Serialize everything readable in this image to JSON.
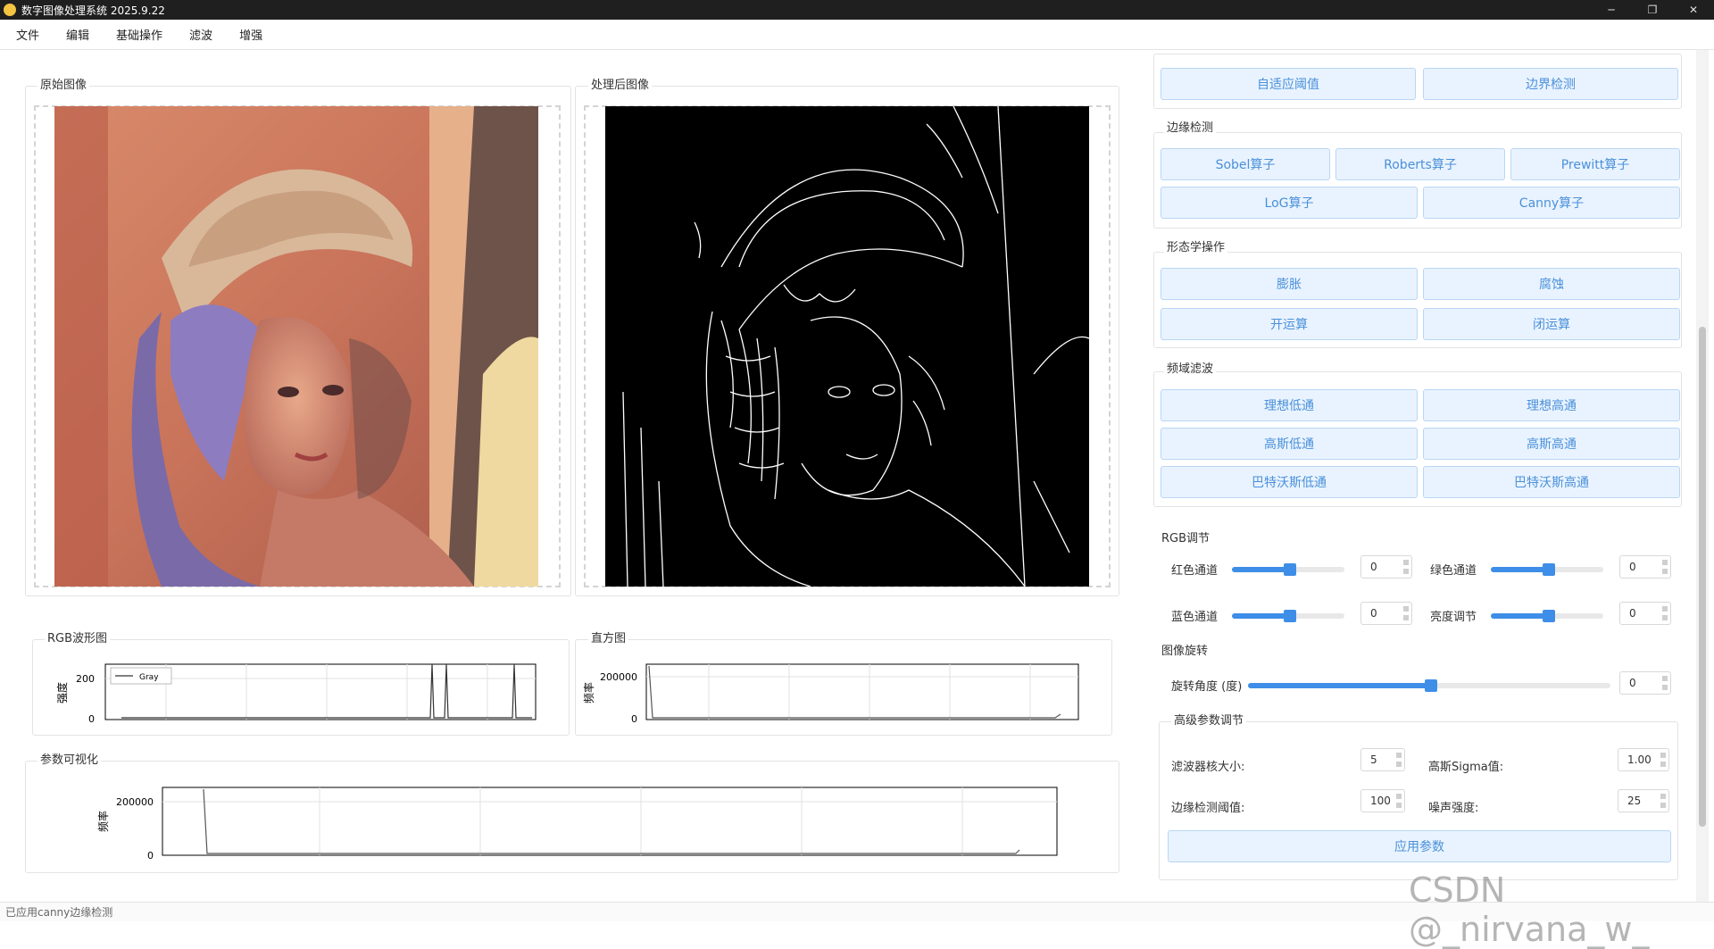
{
  "window": {
    "title": "数字图像处理系统 2025.9.22",
    "minimize": "─",
    "maximize": "❐",
    "close": "✕"
  },
  "menu": [
    "文件",
    "编辑",
    "基础操作",
    "滤波",
    "增强"
  ],
  "panels": {
    "original_title": "原始图像",
    "processed_title": "处理后图像",
    "rgb_wave_title": "RGB波形图",
    "histogram_title": "直方图",
    "param_vis_title": "参数可视化"
  },
  "rgb_wave": {
    "ylabel": "强度",
    "legend": "Gray",
    "y_ticks": [
      "200",
      "0"
    ]
  },
  "histogram": {
    "ylabel": "频率",
    "y_ticks": [
      "200000",
      "0"
    ]
  },
  "param_vis": {
    "ylabel": "频率",
    "y_ticks": [
      "200000",
      "0"
    ]
  },
  "right": {
    "top_buttons": [
      "自适应阈值",
      "边界检测"
    ],
    "edge": {
      "title": "边缘检测",
      "row1": [
        "Sobel算子",
        "Roberts算子",
        "Prewitt算子"
      ],
      "row2": [
        "LoG算子",
        "Canny算子"
      ]
    },
    "morph": {
      "title": "形态学操作",
      "buttons": [
        "膨胀",
        "腐蚀",
        "开运算",
        "闭运算"
      ]
    },
    "freq": {
      "title": "频域滤波",
      "buttons": [
        "理想低通",
        "理想高通",
        "高斯低通",
        "高斯高通",
        "巴特沃斯低通",
        "巴特沃斯高通"
      ]
    },
    "rgb": {
      "title": "RGB调节",
      "red_label": "红色通道",
      "red_value": "0",
      "green_label": "绿色通道",
      "green_value": "0",
      "blue_label": "蓝色通道",
      "blue_value": "0",
      "bright_label": "亮度调节",
      "bright_value": "0"
    },
    "rotate": {
      "title": "图像旋转",
      "label": "旋转角度 (度)",
      "value": "0"
    },
    "advanced": {
      "title": "高级参数调节",
      "kernel_label": "滤波器核大小:",
      "kernel_value": "5",
      "sigma_label": "高斯Sigma值:",
      "sigma_value": "1.00",
      "edge_label": "边缘检测阈值:",
      "edge_value": "100",
      "noise_label": "噪声强度:",
      "noise_value": "25",
      "apply": "应用参数"
    }
  },
  "status": "已应用canny边缘检测",
  "watermark": "CSDN @_nirvana_w_"
}
